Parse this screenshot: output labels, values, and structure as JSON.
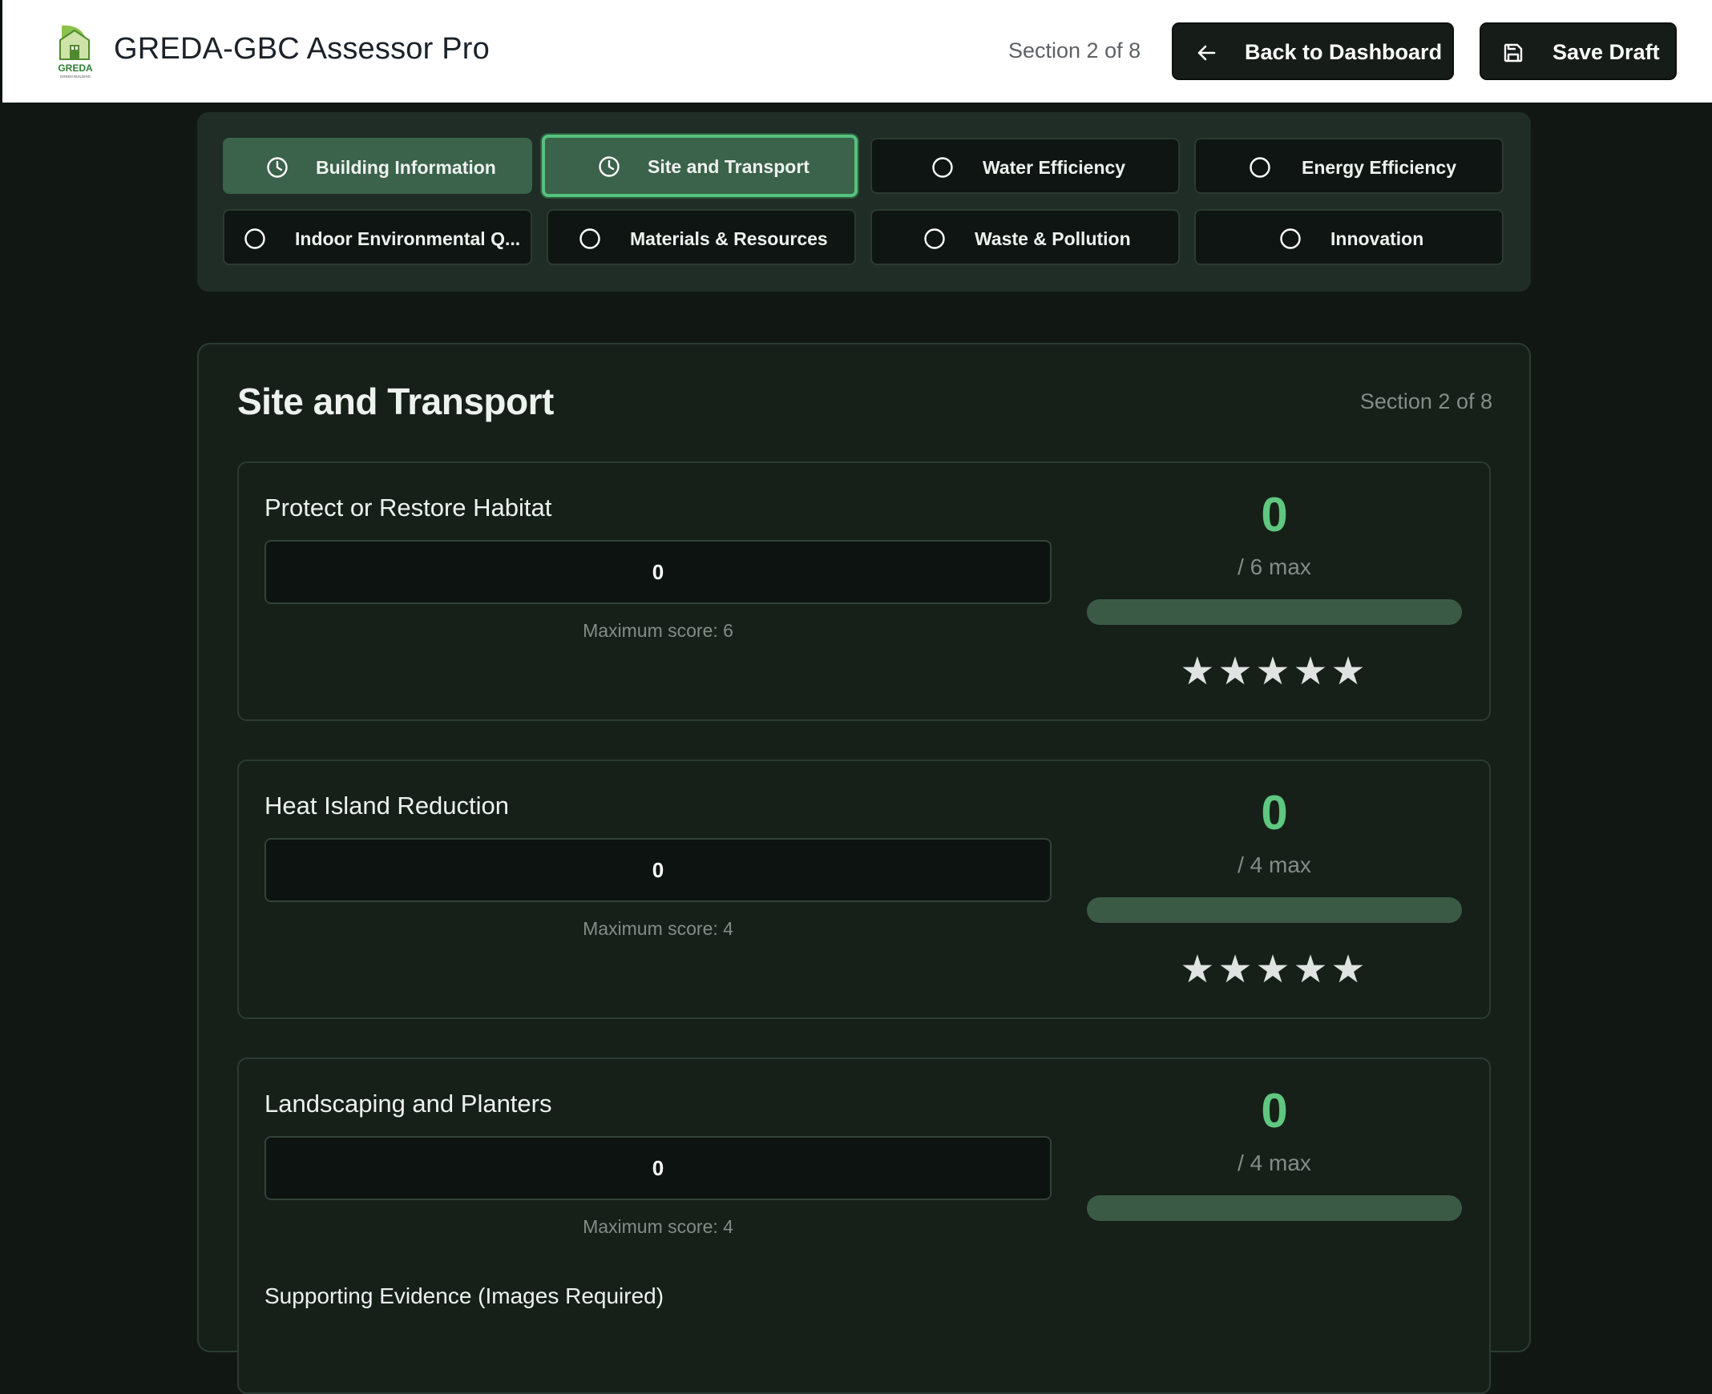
{
  "app": {
    "title": "GREDA-GBC Assessor Pro",
    "logo_text": "GREDA",
    "logo_subtext": "GREEN BUILDING"
  },
  "header": {
    "section_indicator": "Section 2 of 8",
    "back_label": "Back to Dashboard",
    "save_label": "Save Draft"
  },
  "tabs": [
    {
      "label": "Building Information",
      "state": "done",
      "icon": "clock-icon"
    },
    {
      "label": "Site and Transport",
      "state": "active",
      "icon": "clock-icon"
    },
    {
      "label": "Water Efficiency",
      "state": "pending",
      "icon": "circle-icon"
    },
    {
      "label": "Energy Efficiency",
      "state": "pending",
      "icon": "circle-icon"
    },
    {
      "label": "Indoor Environmental Q...",
      "state": "pending",
      "icon": "circle-icon"
    },
    {
      "label": "Materials & Resources",
      "state": "pending",
      "icon": "circle-icon"
    },
    {
      "label": "Waste & Pollution",
      "state": "pending",
      "icon": "circle-icon"
    },
    {
      "label": "Innovation",
      "state": "pending",
      "icon": "circle-icon"
    }
  ],
  "section": {
    "title": "Site and Transport",
    "subtitle": "Section 2 of 8"
  },
  "criteria": [
    {
      "name": "Protect or Restore Habitat",
      "value": "0",
      "max_note": "Maximum score: 6",
      "score": "0",
      "max_label": "/ 6 max",
      "progress": 0,
      "stars": "★★★★★"
    },
    {
      "name": "Heat Island Reduction",
      "value": "0",
      "max_note": "Maximum score: 4",
      "score": "0",
      "max_label": "/ 4 max",
      "progress": 0,
      "stars": "★★★★★"
    },
    {
      "name": "Landscaping and Planters",
      "value": "0",
      "max_note": "Maximum score: 4",
      "score": "0",
      "max_label": "/ 4 max",
      "progress": 0,
      "evidence_label": "Supporting Evidence (Images Required)"
    }
  ],
  "colors": {
    "accent": "#5fc77f",
    "tab_done": "#3b624a",
    "background": "#111814"
  }
}
